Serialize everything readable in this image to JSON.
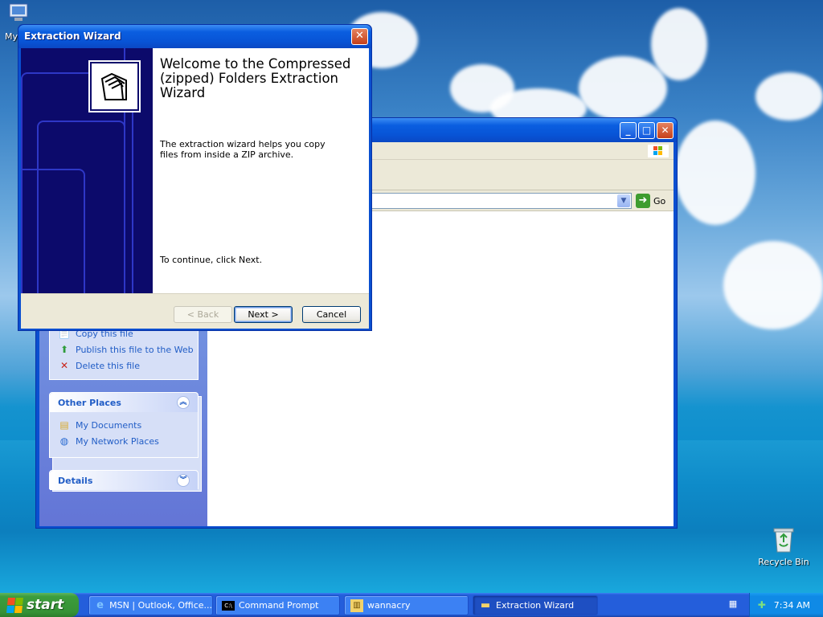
{
  "desktop": {
    "icons": [
      {
        "label": "My",
        "icon": "my-computer-icon"
      },
      {
        "label": "Recycle Bin",
        "icon": "recycle-bin-icon"
      }
    ]
  },
  "explorer": {
    "address": {
      "go_label": "Go"
    },
    "file_tasks": {
      "items": [
        {
          "label": "Copy this file",
          "icon": "copy-icon"
        },
        {
          "label": "Publish this file to the Web",
          "icon": "publish-web-icon"
        },
        {
          "label": "Delete this file",
          "icon": "delete-icon"
        }
      ]
    },
    "other_places": {
      "title": "Other Places",
      "items": [
        {
          "label": "My Documents",
          "icon": "my-documents-icon"
        },
        {
          "label": "My Network Places",
          "icon": "network-places-icon"
        }
      ]
    },
    "details": {
      "title": "Details"
    }
  },
  "wizard": {
    "title": "Extraction Wizard",
    "headline": "Welcome to the Compressed (zipped) Folders Extraction Wizard",
    "description": "The extraction wizard helps you copy files from inside a ZIP archive.",
    "continue_text": "To continue, click Next.",
    "buttons": {
      "back": "< Back",
      "next": "Next >",
      "cancel": "Cancel"
    }
  },
  "taskbar": {
    "start_label": "start",
    "tasks": [
      {
        "label": "MSN | Outlook, Office...",
        "icon": "ie-icon",
        "active": false
      },
      {
        "label": "Command Prompt",
        "icon": "cmd-icon",
        "active": false
      },
      {
        "label": "wannacry",
        "icon": "folder-zip-icon",
        "active": false
      },
      {
        "label": "Extraction Wizard",
        "icon": "folder-icon",
        "active": true
      }
    ],
    "clock": "7:34 AM"
  },
  "colors": {
    "xp_blue": "#0a5ee0",
    "start_green": "#3c9d3c",
    "link_blue": "#215dc6",
    "wizard_side": "#0c0a6b"
  }
}
